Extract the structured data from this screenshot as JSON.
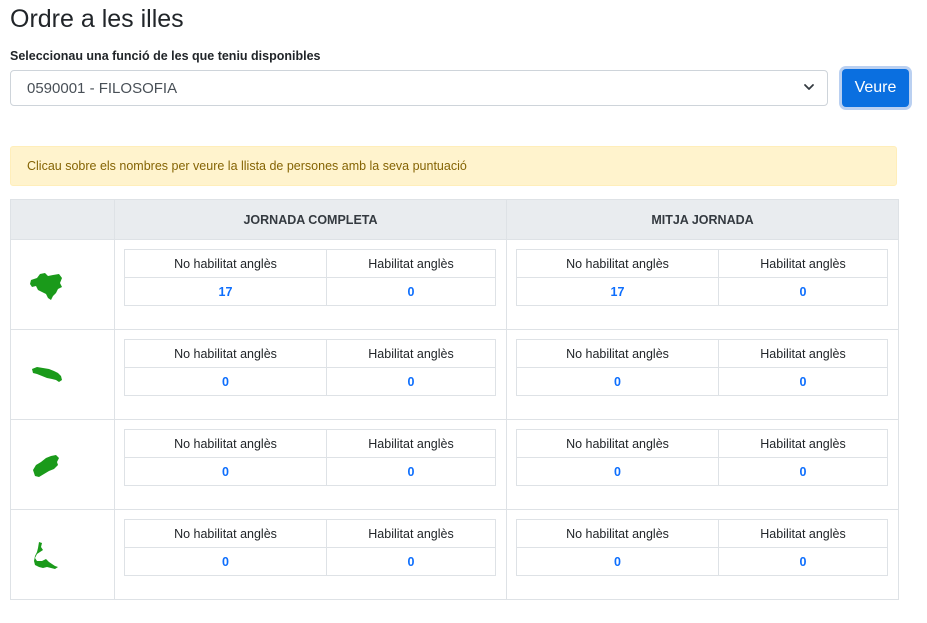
{
  "page_title": "Ordre a les illes",
  "select": {
    "label": "Seleccionau una funció de les que teniu disponibles",
    "value": "0590001 - FILOSOFIA"
  },
  "button": {
    "label": "Veure"
  },
  "alert": {
    "text": "Clicau sobre els nombres per veure la llista de persones amb la seva puntuació"
  },
  "table": {
    "headers": [
      "JORNADA COMPLETA",
      "MITJA JORNADA"
    ],
    "sub_headers": [
      "No habilitat anglès",
      "Habilitat anglès"
    ],
    "island_color": "#1a9a1a",
    "rows": [
      {
        "island_icon": "mallorca-icon",
        "completa": [
          "17",
          "0"
        ],
        "mitja": [
          "17",
          "0"
        ]
      },
      {
        "island_icon": "menorca-icon",
        "completa": [
          "0",
          "0"
        ],
        "mitja": [
          "0",
          "0"
        ]
      },
      {
        "island_icon": "eivissa-icon",
        "completa": [
          "0",
          "0"
        ],
        "mitja": [
          "0",
          "0"
        ]
      },
      {
        "island_icon": "formentera-icon",
        "completa": [
          "0",
          "0"
        ],
        "mitja": [
          "0",
          "0"
        ]
      }
    ]
  },
  "colors": {
    "primary": "#0a6fe0",
    "link": "#0d6efd",
    "alert_bg": "#fff3cd",
    "alert_text": "#856404",
    "header_bg": "#e9ecef"
  }
}
